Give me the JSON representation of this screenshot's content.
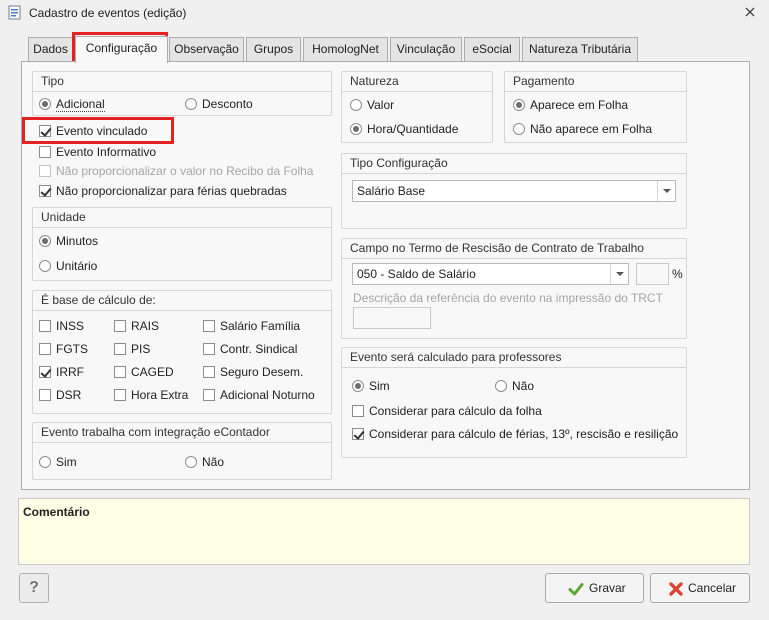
{
  "window": {
    "title": "Cadastro de eventos (edição)"
  },
  "tabs": [
    "Dados",
    "Configuração",
    "Observação",
    "Grupos",
    "HomologNet",
    "Vinculação",
    "eSocial",
    "Natureza Tributária"
  ],
  "tipo": {
    "title": "Tipo",
    "adicional": "Adicional",
    "desconto": "Desconto",
    "selected": "Adicional"
  },
  "flags": {
    "evento_vinculado": {
      "label": "Evento vinculado",
      "checked": true
    },
    "evento_informativo": {
      "label": "Evento Informativo",
      "checked": false
    },
    "nao_proporcionalizar_recibo": {
      "label": "Não proporcionalizar o valor no Recibo da Folha",
      "checked": false,
      "disabled": true
    },
    "nao_proporcionalizar_ferias": {
      "label": "Não proporcionalizar para férias quebradas",
      "checked": true
    }
  },
  "unidade": {
    "title": "Unidade",
    "minutos": "Minutos",
    "unitario": "Unitário",
    "selected": "Minutos"
  },
  "base_calculo": {
    "title": "É base de cálculo de:",
    "items": [
      {
        "label": "INSS",
        "checked": false
      },
      {
        "label": "RAIS",
        "checked": false
      },
      {
        "label": "Salário Família",
        "checked": false
      },
      {
        "label": "FGTS",
        "checked": false
      },
      {
        "label": "PIS",
        "checked": false
      },
      {
        "label": "Contr. Sindical",
        "checked": false
      },
      {
        "label": "IRRF",
        "checked": true
      },
      {
        "label": "CAGED",
        "checked": false
      },
      {
        "label": "Seguro Desem.",
        "checked": false
      },
      {
        "label": "DSR",
        "checked": false
      },
      {
        "label": "Hora Extra",
        "checked": false
      },
      {
        "label": "Adicional Noturno",
        "checked": false
      }
    ]
  },
  "econtador": {
    "title": "Evento trabalha com integração eContador",
    "sim": "Sim",
    "nao": "Não"
  },
  "natureza": {
    "title": "Natureza",
    "valor": "Valor",
    "hora_quantidade": "Hora/Quantidade",
    "selected": "Hora/Quantidade"
  },
  "pagamento": {
    "title": "Pagamento",
    "aparece": "Aparece em Folha",
    "nao_aparece": "Não aparece em Folha",
    "selected": "Aparece em Folha"
  },
  "tipo_configuracao": {
    "title": "Tipo Configuração",
    "value": "Salário Base"
  },
  "trct": {
    "title": "Campo no Termo de Rescisão de Contrato de Trabalho",
    "value": "050 - Saldo de Salário",
    "percent_symbol": "%",
    "desc_label": "Descrição da referência do evento na impressão do TRCT"
  },
  "professores": {
    "title": "Evento será calculado para professores",
    "sim": "Sim",
    "nao": "Não",
    "selected": "Sim",
    "considerar_folha": {
      "label": "Considerar para cálculo da folha",
      "checked": false
    },
    "considerar_ferias": {
      "label": "Considerar para cálculo de férias, 13º, rescisão e resilição",
      "checked": true
    }
  },
  "comentario": {
    "label": "Comentário"
  },
  "buttons": {
    "help": "?",
    "gravar": "Gravar",
    "cancelar": "Cancelar"
  },
  "colors": {
    "highlight": "#e32222",
    "comment_bg": "#fefee6",
    "save_icon": "#5aa832",
    "cancel_icon": "#d9452e"
  }
}
